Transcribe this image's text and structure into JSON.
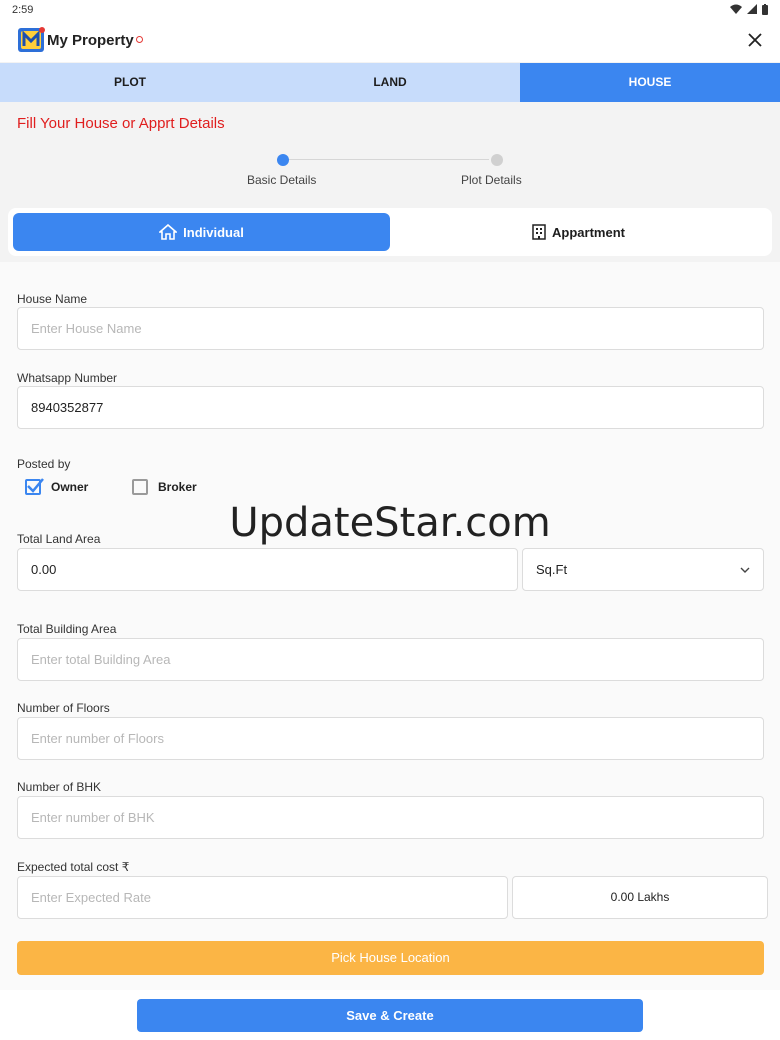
{
  "status_bar": {
    "time": "2:59"
  },
  "app": {
    "title": "My Property"
  },
  "tabs": [
    {
      "label": "PLOT",
      "active": false
    },
    {
      "label": "LAND",
      "active": false
    },
    {
      "label": "HOUSE",
      "active": true
    }
  ],
  "form": {
    "title": "Fill Your House or Apprt Details",
    "steps": [
      "Basic Details",
      "Plot Details"
    ],
    "types": {
      "individual": "Individual",
      "appartment": "Appartment"
    },
    "house_name": {
      "label": "House Name",
      "placeholder": "Enter House Name",
      "value": ""
    },
    "whatsapp": {
      "label": "Whatsapp Number",
      "value": "8940352877"
    },
    "posted_by": {
      "label": "Posted by",
      "owner": "Owner",
      "broker": "Broker",
      "owner_checked": true,
      "broker_checked": false
    },
    "land_area": {
      "label": "Total Land Area",
      "value": "0.00",
      "unit": "Sq.Ft"
    },
    "building_area": {
      "label": "Total Building Area",
      "placeholder": "Enter total Building Area"
    },
    "floors": {
      "label": "Number of Floors",
      "placeholder": "Enter number of Floors"
    },
    "bhk": {
      "label": "Number of BHK",
      "placeholder": "Enter number of BHK"
    },
    "cost": {
      "label": "Expected total cost ₹",
      "placeholder": "Enter Expected Rate",
      "lakhs": "0.00 Lakhs"
    },
    "pick_location": "Pick House Location",
    "save": "Save & Create"
  },
  "watermark": "UpdateStar.com",
  "colors": {
    "primary": "#3b86f0",
    "accent": "#fbb545",
    "title_red": "#e01e1e",
    "tab_bg": "#c7dcfb"
  }
}
